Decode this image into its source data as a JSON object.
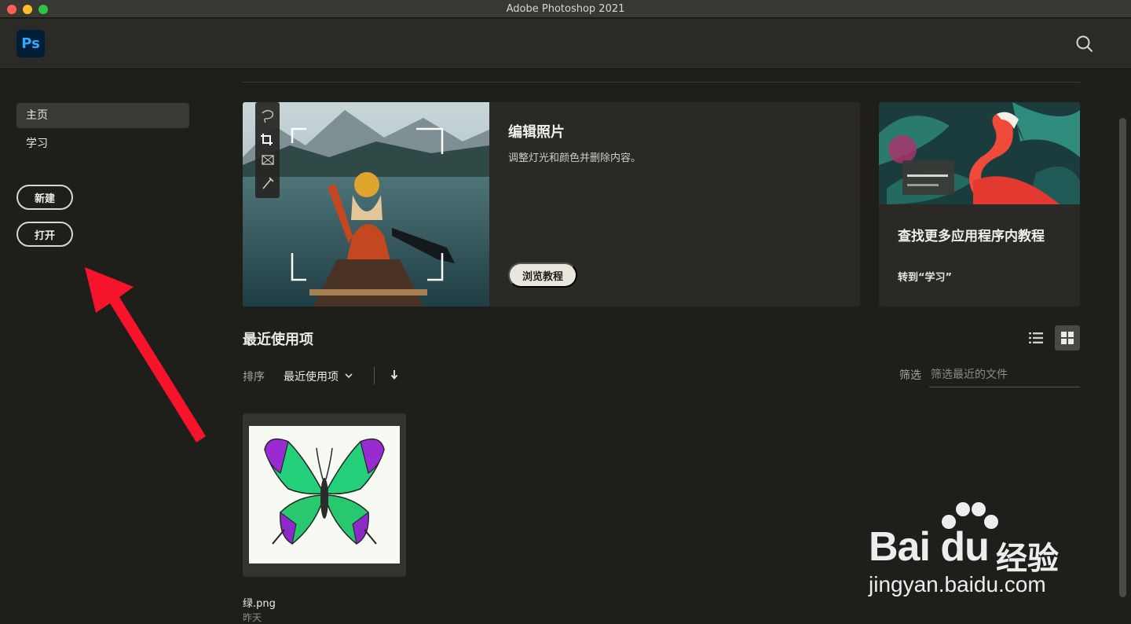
{
  "window": {
    "title": "Adobe Photoshop 2021"
  },
  "app": {
    "logo_text": "Ps"
  },
  "sidebar": {
    "items": [
      {
        "label": "主页",
        "active": true
      },
      {
        "label": "学习",
        "active": false
      }
    ],
    "new_label": "新建",
    "open_label": "打开"
  },
  "hero": {
    "title": "编辑照片",
    "subtitle": "调整灯光和颜色并删除内容。",
    "button_label": "浏览教程"
  },
  "tutorial_card": {
    "title": "查找更多应用程序内教程",
    "link": "转到“学习”"
  },
  "recent": {
    "title": "最近使用项",
    "sort_label": "排序",
    "sort_value": "最近使用项",
    "filter_label": "筛选",
    "filter_placeholder": "筛选最近的文件",
    "view": "grid",
    "files": [
      {
        "name": "绿.png",
        "date": "昨天"
      }
    ]
  },
  "watermark": {
    "brand": "Bai du",
    "brand_cn": "经验",
    "url": "jingyan.baidu.com"
  },
  "colors": {
    "accent_ps": "#31a8ff",
    "background": "#1e1e1b",
    "annotation_arrow": "#f5142c"
  }
}
